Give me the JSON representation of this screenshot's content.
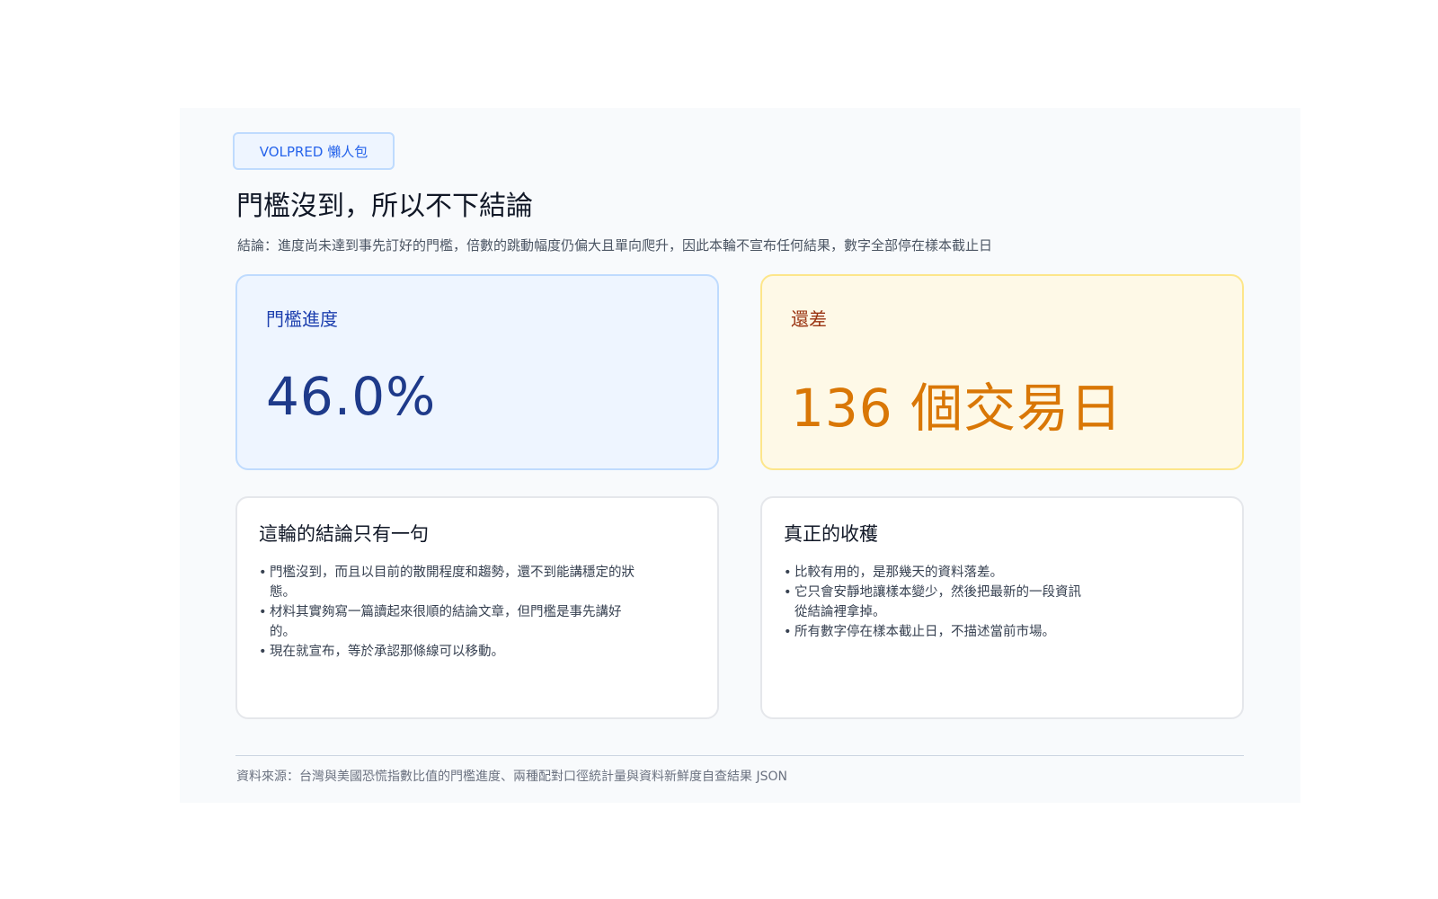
{
  "badge": "VOLPRED 懶人包",
  "title": "門檻沒到，所以不下結論",
  "summary": "結論：進度尚未達到事先訂好的門檻，倍數的跳動幅度仍偏大且單向爬升，因此本輪不宣布任何結果，數字全部停在樣本截止日",
  "progress_card": {
    "label": "門檻進度",
    "value": "46.0%",
    "progress_percent": 46.0
  },
  "remaining_card": {
    "label": "還差",
    "value": "136 個交易日"
  },
  "note_card": {
    "title": "這輪的結論只有一句",
    "items": [
      "門檻沒到，而且以目前的散開程度和趨勢，還不到能講穩定的狀態。",
      "材料其實夠寫一篇讀起來很順的結論文章，但門檻是事先講好的。",
      "現在就宣布，等於承認那條線可以移動。"
    ]
  },
  "gain_card": {
    "title": "真正的收穫",
    "items": [
      "比較有用的，是那幾天的資料落差。",
      "它只會安靜地讓樣本變少，然後把最新的一段資訊從結論裡拿掉。",
      "所有數字停在樣本截止日，不描述當前市場。"
    ]
  },
  "footer": "資料來源：台灣與美國恐慌指數比值的門檻進度、兩種配對口徑統計量與資料新鮮度自查結果 JSON",
  "colors": {
    "accent_blue": "#2563eb",
    "value_blue": "#1e3a8a",
    "value_orange": "#d97706",
    "label_brown": "#9a3412"
  }
}
